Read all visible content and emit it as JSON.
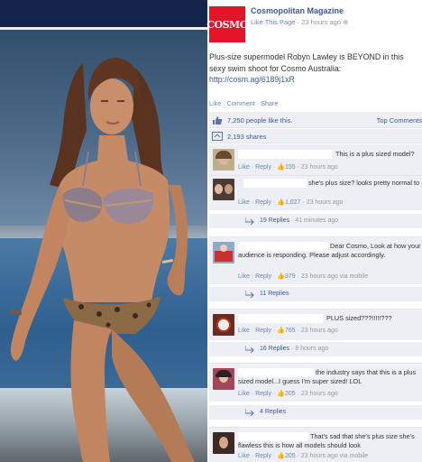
{
  "page": {
    "name": "Cosmopolitan Magazine",
    "logo_text": "COSMO",
    "like_page": "Like This Page",
    "time": "23 hours ago"
  },
  "post": {
    "text": "Plus-size supermodel Robyn Lawley is BEYOND in this sexy swim shoot for Cosmo Australia: ",
    "link": "http://cosm.ag/6189j1xR",
    "actions": {
      "like": "Like",
      "comment": "Comment",
      "share": "Share"
    }
  },
  "stats": {
    "likes": "7,250 people like this.",
    "top_comments": "Top Comments",
    "shares": "2,193 shares"
  },
  "comments": [
    {
      "text": "This is a plus sized model?",
      "meta_like": "Like",
      "meta_reply": "Reply",
      "likes": "155",
      "time": "23 hours ago"
    },
    {
      "text": "she's plus size? looks pretty normal to me. Our society is fucked.",
      "meta_like": "Like",
      "meta_reply": "Reply",
      "likes": "1,027",
      "time": "23 hours ago",
      "replies": "19 Replies",
      "replies_time": "41 minutes ago"
    },
    {
      "text": "Dear Cosmo, Look at how your audience is responding. Please adjust accordingly.",
      "meta_like": "Like",
      "meta_reply": "Reply",
      "likes": "379",
      "time": "23 hours ago via mobile",
      "replies": "11 Replies"
    },
    {
      "text": "PLUS sized???!!!!!???",
      "meta_like": "Like",
      "meta_reply": "Reply",
      "likes": "765",
      "time": "23 hours ago",
      "replies": "16 Replies",
      "replies_time": "8 hours ago"
    },
    {
      "text": "the industry says that this is a plus sized model...I guess I'm super sized! LOL",
      "meta_like": "Like",
      "meta_reply": "Reply",
      "likes": "205",
      "time": "23 hours ago",
      "replies": "4 Replies"
    },
    {
      "text": "That's sad that she's plus size she's flawless this is how all models should look",
      "meta_like": "Like",
      "meta_reply": "Reply",
      "likes": "205",
      "time": "23 hours ago via mobile"
    }
  ],
  "colors": {
    "brand_blue": "#3b5998",
    "link_blue": "#6d84b4",
    "cosmo_red": "#e4152b",
    "panel_bg": "#edeff4"
  },
  "icons": [
    "thumbs-up-icon",
    "share-icon",
    "reply-arrow-icon",
    "globe-icon"
  ]
}
